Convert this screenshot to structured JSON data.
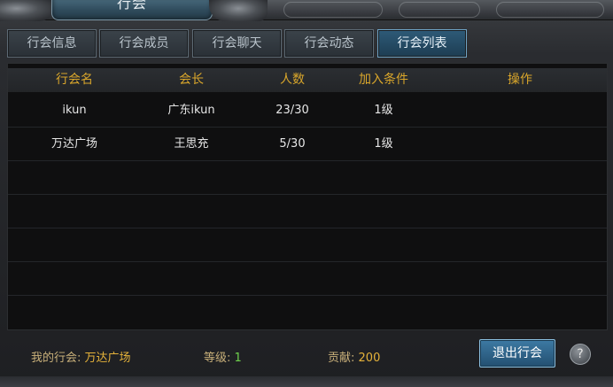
{
  "window": {
    "title": "行会"
  },
  "tabs": [
    {
      "label": "行会信息",
      "active": false
    },
    {
      "label": "行会成员",
      "active": false
    },
    {
      "label": "行会聊天",
      "active": false
    },
    {
      "label": "行会动态",
      "active": false
    },
    {
      "label": "行会列表",
      "active": true
    }
  ],
  "table": {
    "headers": [
      "行会名",
      "会长",
      "人数",
      "加入条件",
      "操作"
    ],
    "rows": [
      {
        "name": "ikun",
        "leader": "广东ikun",
        "members": "23/30",
        "condition": "1级",
        "action": ""
      },
      {
        "name": "万达广场",
        "leader": "王思充",
        "members": "5/30",
        "condition": "1级",
        "action": ""
      }
    ]
  },
  "footer": {
    "my_guild_label": "我的行会:",
    "my_guild_value": "万达广场",
    "level_label": "等级:",
    "level_value": "1",
    "contribution_label": "贡献:",
    "contribution_value": "200",
    "exit_button": "退出行会",
    "help_icon": "?"
  },
  "colors": {
    "header_text": "#d9a62b",
    "active_tab": "#2e5b78",
    "level_value": "#6ed04c",
    "gold_value": "#e5b23a"
  }
}
